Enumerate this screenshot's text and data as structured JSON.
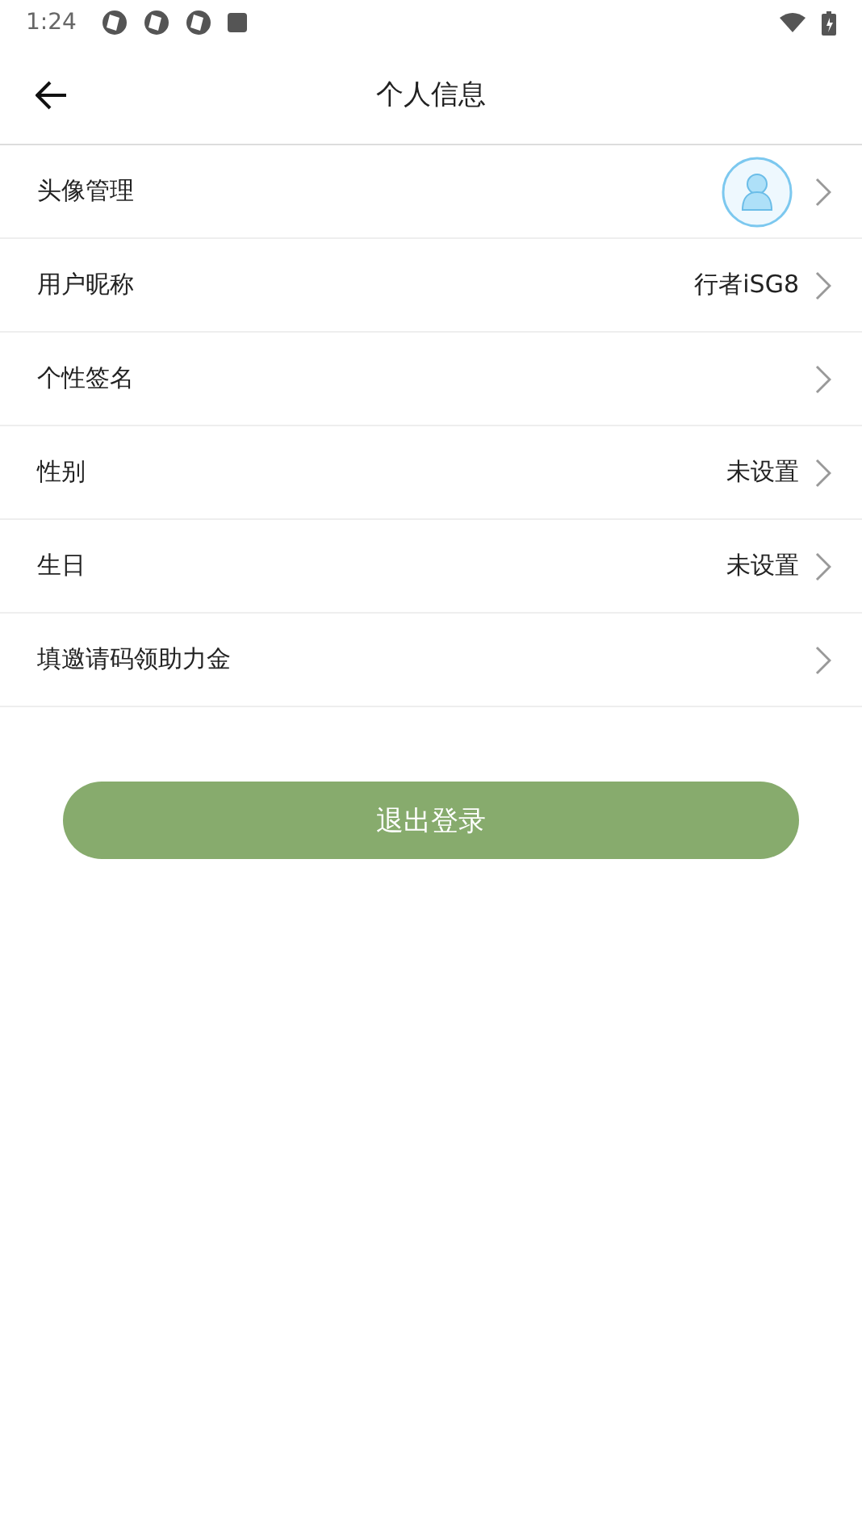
{
  "status_bar": {
    "time": "1:24"
  },
  "header": {
    "title": "个人信息"
  },
  "rows": [
    {
      "label": "头像管理",
      "kind": "avatar"
    },
    {
      "label": "用户昵称",
      "kind": "text",
      "value": "行者iSG8"
    },
    {
      "label": "个性签名",
      "kind": "text"
    },
    {
      "label": "性别",
      "kind": "text",
      "value": "未设置"
    },
    {
      "label": "生日",
      "kind": "text",
      "value": "未设置"
    },
    {
      "label": "填邀请码领助力金",
      "kind": "text"
    }
  ],
  "logout_button": "退出登录"
}
